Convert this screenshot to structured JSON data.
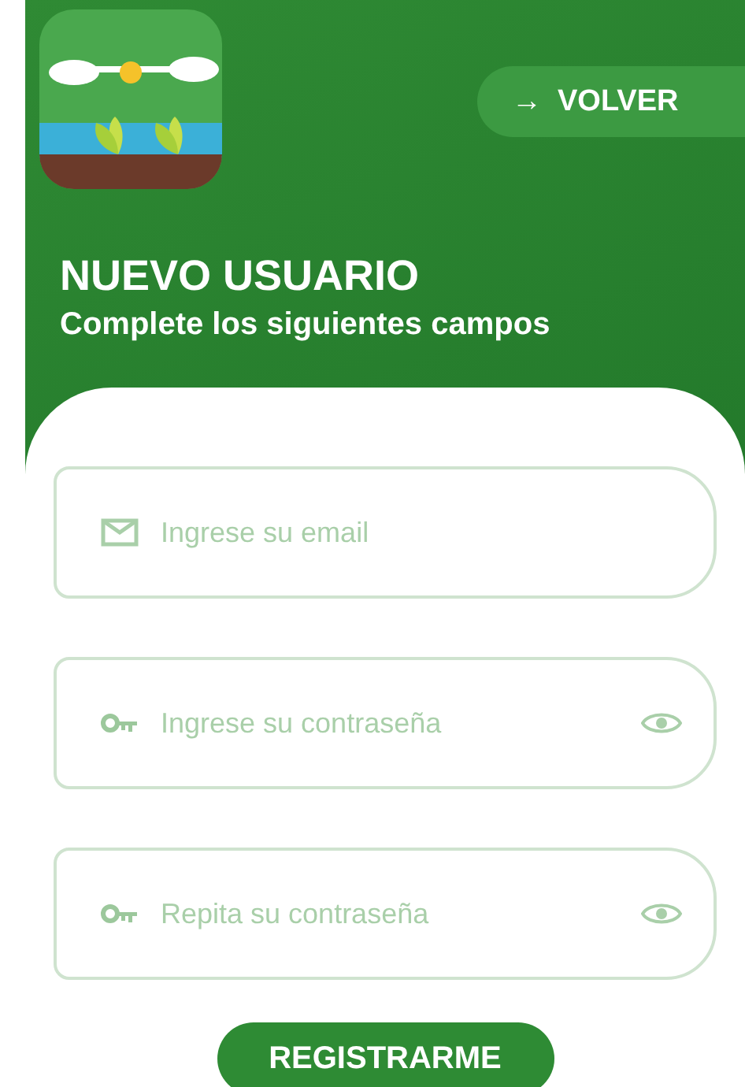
{
  "header": {
    "back_button": {
      "arrow": "→",
      "label": "VOLVER"
    },
    "title": "NUEVO USUARIO",
    "subtitle": "Complete los siguientes campos"
  },
  "fields": [
    {
      "kind": "email",
      "placeholder": "Ingrese su email"
    },
    {
      "kind": "password",
      "placeholder": "Ingrese su contraseña"
    },
    {
      "kind": "password",
      "placeholder": "Repita su contraseña"
    }
  ],
  "submit_button": "REGISTRARME"
}
